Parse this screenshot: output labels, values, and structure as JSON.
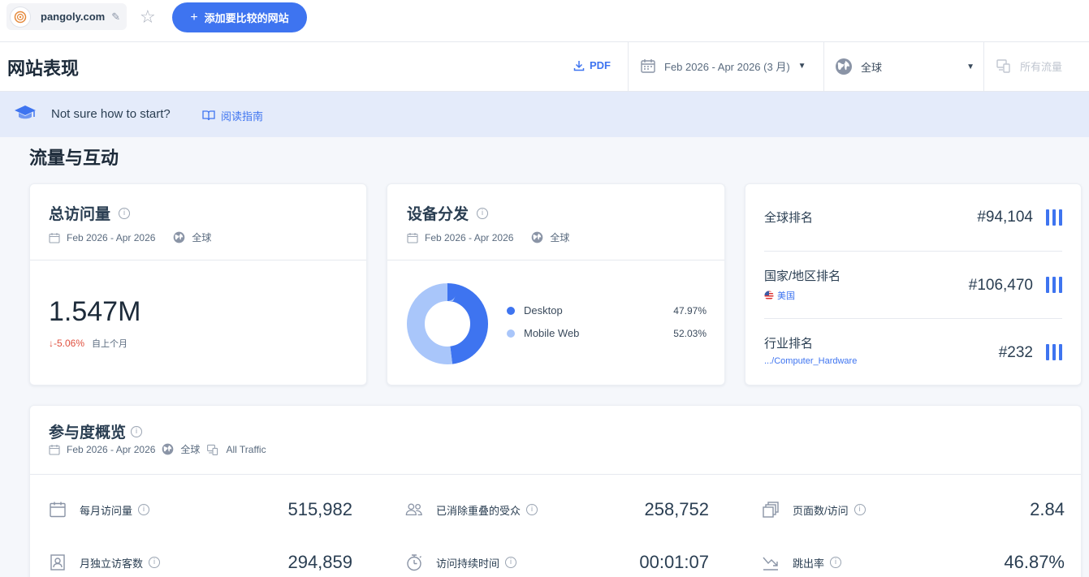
{
  "topbar": {
    "site_name": "pangoly.com",
    "add_button_label": "添加要比较的网站"
  },
  "header": {
    "title": "网站表现",
    "pdf_label": "PDF",
    "date_range": "Feb 2026 - Apr 2026 (3 月)",
    "country": "全球",
    "traffic": "所有流量"
  },
  "banner": {
    "text": "Not sure how to start?",
    "guide_label": "阅读指南"
  },
  "section_title": "流量与互动",
  "visits_card": {
    "title": "总访问量",
    "date": "Feb 2026 - Apr 2026",
    "region": "全球",
    "value": "1.547M",
    "change": "-5.06%",
    "change_caption": "自上个月"
  },
  "device_card": {
    "title": "设备分发",
    "date": "Feb 2026 - Apr 2026",
    "region": "全球",
    "items": [
      {
        "label": "Desktop",
        "value": "47.97%",
        "fraction": 0.4797,
        "color": "#3e74f0"
      },
      {
        "label": "Mobile Web",
        "value": "52.03%",
        "fraction": 0.5203,
        "color": "#a9c6fa"
      }
    ]
  },
  "rank_card": {
    "global_label": "全球排名",
    "global_value": "#94,104",
    "country_label": "国家/地区排名",
    "country_sub": "美国",
    "country_value": "#106,470",
    "industry_label": "行业排名",
    "industry_sub": ".../Computer_Hardware",
    "industry_value": "#232"
  },
  "engagement": {
    "title": "参与度概览",
    "date": "Feb 2026 - Apr 2026",
    "region": "全球",
    "traffic": "All Traffic",
    "metrics": [
      {
        "label": "每月访问量",
        "value": "515,982",
        "icon": "calendar-icon"
      },
      {
        "label": "已消除重叠的受众",
        "value": "258,752",
        "icon": "users-icon"
      },
      {
        "label": "页面数/访问",
        "value": "2.84",
        "icon": "pages-icon"
      },
      {
        "label": "月独立访客数",
        "value": "294,859",
        "icon": "visitor-card-icon"
      },
      {
        "label": "访问持续时间",
        "value": "00:01:07",
        "icon": "stopwatch-icon"
      },
      {
        "label": "跳出率",
        "value": "46.87%",
        "icon": "bounce-icon"
      }
    ]
  }
}
